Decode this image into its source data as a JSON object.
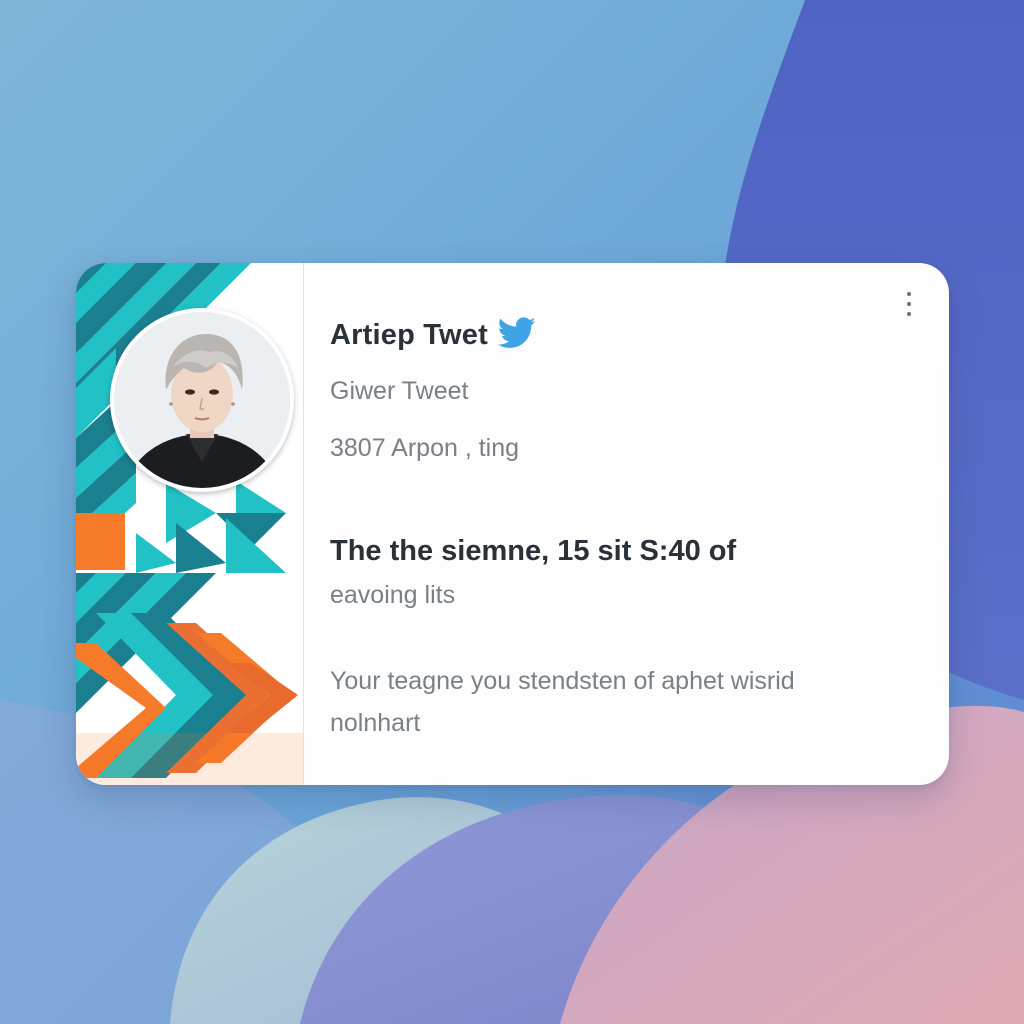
{
  "card": {
    "title": "Artiep Twet",
    "subtitle": "Giwer Tweet",
    "meta": "3807 Arpon , ting",
    "headline": "The the siemne, 15 sit S:40 of",
    "headline_sub": "eavoing lits",
    "body_line1": "Your teagne you stendsten of aphet wisrid",
    "body_line2": "nolnhart"
  },
  "icons": {
    "brand": "twitter-bird-icon",
    "menu": "more-vertical-icon",
    "avatar": "profile-photo"
  },
  "colors": {
    "teal": "#1fb8bf",
    "dark_teal": "#1a7f8f",
    "orange": "#f57a2a",
    "twitter_blue": "#3fa3e6",
    "title_text": "#2b3138",
    "secondary_text": "#7a8088"
  }
}
